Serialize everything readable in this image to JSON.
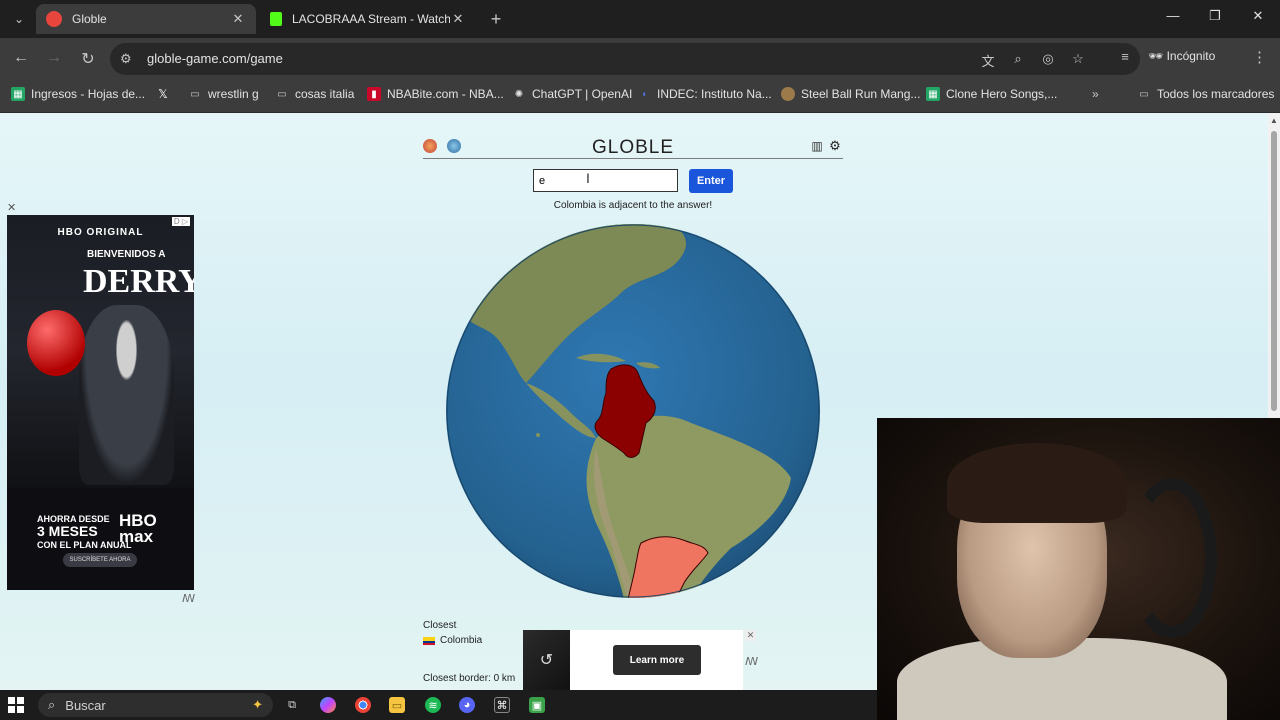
{
  "tabs": [
    {
      "title": "Globle",
      "active": true,
      "favicon_color": "#e8453c"
    },
    {
      "title": "LACOBRAAA Stream - Watch Li",
      "active": false,
      "favicon_color": "#53fc18"
    }
  ],
  "toolbar": {
    "url": "globle-game.com/game",
    "incognito_label": "Incógnito"
  },
  "bookmarks": [
    {
      "label": "Ingresos - Hojas de...",
      "icon": "sheets-icon"
    },
    {
      "label": "",
      "icon": "x-icon"
    },
    {
      "label": "wrestlin g",
      "icon": "folder-icon"
    },
    {
      "label": "cosas italia",
      "icon": "folder-icon"
    },
    {
      "label": "NBABite.com - NBA...",
      "icon": "nba-icon"
    },
    {
      "label": "ChatGPT | OpenAI",
      "icon": "openai-icon"
    },
    {
      "label": "INDEC: Instituto Na...",
      "icon": "indec-icon"
    },
    {
      "label": "Steel Ball Run Mang...",
      "icon": "manga-icon"
    },
    {
      "label": "Clone Hero Songs,...",
      "icon": "sheets-icon"
    },
    {
      "label": "Todos los marcadores",
      "icon": "folder-icon"
    }
  ],
  "game": {
    "title": "GLOBLE",
    "input_value": "e",
    "enter_label": "Enter",
    "hint": "Colombia is adjacent to the answer!",
    "closest_label": "Closest",
    "closest_country": "Colombia",
    "closest_border": "Closest border: 0  km"
  },
  "left_ad": {
    "brand_top": "HBO ORIGINAL",
    "headline_small": "BIENVENIDOS A",
    "headline_big": "DERRY",
    "offer_line1": "AHORRA DESDE",
    "offer_line2": "3 MESES",
    "offer_line3": "CON EL PLAN ANUAL",
    "logo_line1": "HBO",
    "logo_line2": "max",
    "cta": "SUSCRÍBETE AHORA"
  },
  "bottom_ad": {
    "cta": "Learn more"
  },
  "taskbar": {
    "search_placeholder": "Buscar"
  },
  "colors": {
    "enter_button": "#1a56db",
    "colombia_fill": "#8b0000",
    "argentina_fill": "#f07560",
    "ocean": "#2d6ea3"
  }
}
